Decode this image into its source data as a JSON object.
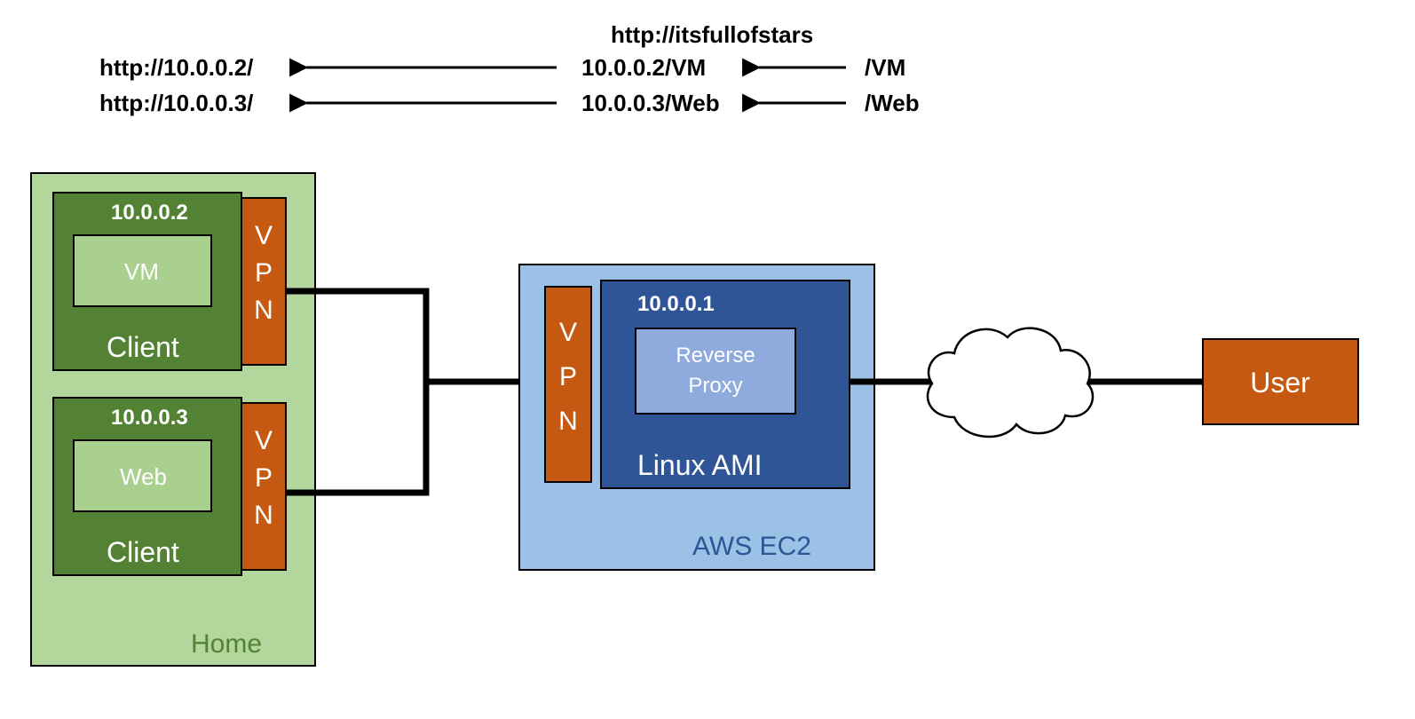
{
  "header": {
    "title": "http://itsfullofstars",
    "row1_left": "http://10.0.0.2/",
    "row1_mid": "10.0.0.2/VM",
    "row1_right": "/VM",
    "row2_left": "http://10.0.0.3/",
    "row2_mid": "10.0.0.3/Web",
    "row2_right": "/Web"
  },
  "home": {
    "label": "Home",
    "client1": {
      "ip": "10.0.0.2",
      "service": "VM",
      "label": "Client",
      "vpn": "VPN"
    },
    "client2": {
      "ip": "10.0.0.3",
      "service": "Web",
      "label": "Client",
      "vpn": "VPN"
    }
  },
  "aws": {
    "label": "AWS EC2",
    "vpn": "VPN",
    "ip": "10.0.0.1",
    "proxy_line1": "Reverse",
    "proxy_line2": "Proxy",
    "ami": "Linux AMI"
  },
  "user": {
    "label": "User"
  },
  "colors": {
    "light_green": "#b2d69b",
    "dark_green": "#548235",
    "inner_green": "#a9d08e",
    "orange": "#c65911",
    "light_blue": "#9bc2e6",
    "dark_blue": "#2f5597",
    "inner_blue": "#8faadc",
    "white": "#ffffff"
  }
}
